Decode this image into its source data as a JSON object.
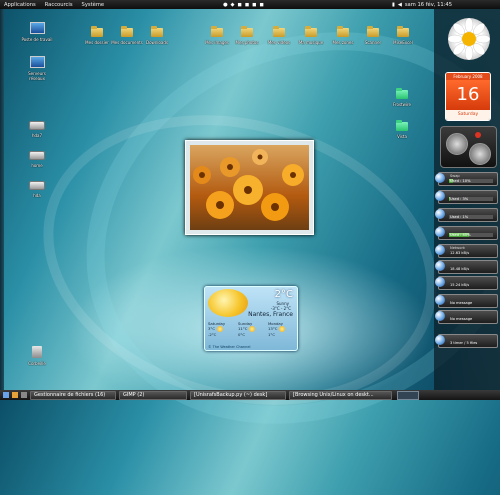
{
  "topbar": {
    "menus": [
      "Applications",
      "Raccourcis",
      "Système"
    ],
    "clock": "sam 16 fév, 11:45"
  },
  "desktop": {
    "left_icons": [
      {
        "label": "Poste de travail",
        "kind": "monitor"
      },
      {
        "label": "Serveurs réseaux",
        "kind": "monitor"
      },
      {
        "label": "hda7",
        "kind": "drive"
      },
      {
        "label": "home",
        "kind": "drive"
      },
      {
        "label": "hda",
        "kind": "drive"
      }
    ],
    "top_icons": [
      {
        "label": "Mes dossier",
        "kind": "folder"
      },
      {
        "label": "Mes documents",
        "kind": "folder"
      },
      {
        "label": "Downloads",
        "kind": "folder"
      },
      {
        "label": "Mes images",
        "kind": "folder"
      },
      {
        "label": "Mes photos",
        "kind": "folder"
      },
      {
        "label": "Mes videos",
        "kind": "folder"
      },
      {
        "label": "Ma musique",
        "kind": "folder"
      },
      {
        "label": "Mes zones",
        "kind": "folder"
      },
      {
        "label": "Scanner",
        "kind": "folder"
      },
      {
        "label": "MiseExcel",
        "kind": "folder"
      }
    ],
    "right_icons": [
      {
        "label": "Frostwire",
        "kind": "file"
      },
      {
        "label": "Vista",
        "kind": "file"
      }
    ],
    "trash_label": "Corbeille"
  },
  "widgets": {
    "calendar": {
      "month": "February 2008",
      "day": "16",
      "weekday": "Saturday"
    },
    "weather": {
      "temp": "2°C",
      "condition": "Sunny",
      "range": "-3°C - 2°C",
      "city": "Nantes, France",
      "days": [
        {
          "name": "Saturday",
          "hi": "3°C",
          "lo": "-2°C"
        },
        {
          "name": "Sunday",
          "hi": "11°C",
          "lo": "0°C"
        },
        {
          "name": "Monday",
          "hi": "13°C",
          "lo": "1°C"
        }
      ],
      "credit": "© The Weather Channel"
    },
    "side_meters": [
      {
        "top": "Swap",
        "line": "Used : 10%",
        "level": 0.1
      },
      {
        "top": "",
        "line": "Used : 3%",
        "level": 0.03
      },
      {
        "top": "",
        "line": "Used : 1%",
        "level": 0.01
      },
      {
        "top": "",
        "line": "Used : 45%",
        "level": 0.45
      },
      {
        "top": "",
        "line": "",
        "level": 0.0
      }
    ],
    "side_status": [
      {
        "top": "Network",
        "line": "12.63 kB/s"
      },
      {
        "top": "",
        "line": "18.48 kB/s"
      },
      {
        "top": "",
        "line": "15.24 kB/s"
      },
      {
        "top": "",
        "line": "No message"
      },
      {
        "top": "",
        "line": "No message"
      },
      {
        "top": "",
        "line": "3 timer / 5 files"
      }
    ]
  },
  "taskbar": {
    "tasks": [
      "Gestionnaire de fichiers (16)",
      "GIMP (2)",
      "[UnisrafsBackup.py (~) desk]",
      "[Browsing Unix/Linux on deskt..."
    ]
  }
}
